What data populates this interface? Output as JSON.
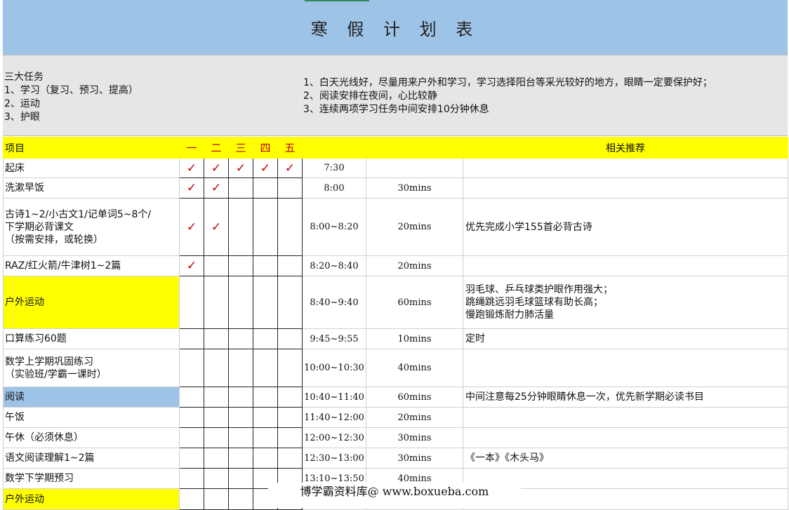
{
  "title": "寒 假 计 划 表",
  "tasks": {
    "heading": "三大任务",
    "items": [
      "1、学习（复习、预习、提高）",
      "2、运动",
      "3、护眼"
    ]
  },
  "notes": [
    "1、白天光线好，尽量用来户外和学习，学习选择阳台等采光较好的地方，眼睛一定要保护好；",
    "2、阅读安排在夜间，心比较静",
    "3、连续两项学习任务中间安排10分钟休息"
  ],
  "table": {
    "headers": {
      "item": "项目",
      "days": [
        "一",
        "二",
        "三",
        "四",
        "五"
      ],
      "recommend": "相关推荐"
    },
    "check_mark": "✓",
    "rows": [
      {
        "item": [
          "起床"
        ],
        "checks": [
          1,
          1,
          1,
          1,
          1
        ],
        "time": "7:30",
        "duration": "",
        "recommend": [],
        "style": ""
      },
      {
        "item": [
          "洗漱早饭"
        ],
        "checks": [
          1,
          1,
          0,
          0,
          0
        ],
        "time": "8:00",
        "duration": "30mins",
        "recommend": [],
        "style": ""
      },
      {
        "item": [
          "古诗1~2/小古文1/记单词5~8个/",
          "下学期必背课文",
          "（按需安排，或轮换）"
        ],
        "checks": [
          1,
          1,
          0,
          0,
          0
        ],
        "time": "8:00~8:20",
        "duration": "20mins",
        "recommend": [
          "优先完成小学155首必背古诗"
        ],
        "style": ""
      },
      {
        "item": [
          "RAZ/红火箭/牛津树1~2篇"
        ],
        "checks": [
          1,
          0,
          0,
          0,
          0
        ],
        "time": "8:20~8:40",
        "duration": "20mins",
        "recommend": [],
        "style": ""
      },
      {
        "item": [
          "户外运动"
        ],
        "checks": [
          0,
          0,
          0,
          0,
          0
        ],
        "time": "8:40~9:40",
        "duration": "60mins",
        "recommend": [
          "羽毛球、乒乓球类护眼作用强大；",
          "跳绳跳远羽毛球篮球有助长高；",
          "慢跑锻炼耐力肺活量"
        ],
        "style": "yellow"
      },
      {
        "item": [
          "口算练习60题"
        ],
        "checks": [
          0,
          0,
          0,
          0,
          0
        ],
        "time": "9:45~9:55",
        "duration": "10mins",
        "recommend": [
          "定时"
        ],
        "style": ""
      },
      {
        "item": [
          "数学上学期巩固练习",
          "（实验班/学霸一课时）"
        ],
        "checks": [
          0,
          0,
          0,
          0,
          0
        ],
        "time": "10:00~10:30",
        "duration": "40mins",
        "recommend": [],
        "style": ""
      },
      {
        "item": [
          "阅读"
        ],
        "checks": [
          0,
          0,
          0,
          0,
          0
        ],
        "time": "10:40~11:40",
        "duration": "60mins",
        "recommend": [
          "中间注意每25分钟眼睛休息一次，优先新学期必读书目"
        ],
        "style": "blue"
      },
      {
        "item": [
          "午饭"
        ],
        "checks": [
          0,
          0,
          0,
          0,
          0
        ],
        "time": "11:40~12:00",
        "duration": "20mins",
        "recommend": [],
        "style": ""
      },
      {
        "item": [
          "午休（必须休息）"
        ],
        "checks": [
          0,
          0,
          0,
          0,
          0
        ],
        "time": "12:00~12:30",
        "duration": "30mins",
        "recommend": [],
        "style": ""
      },
      {
        "item": [
          "语文阅读理解1~2篇"
        ],
        "checks": [
          0,
          0,
          0,
          0,
          0
        ],
        "time": "12:30~13:00",
        "duration": "30mins",
        "recommend": [
          "《一本》《木头马》"
        ],
        "style": ""
      },
      {
        "item": [
          "数学下学期预习"
        ],
        "checks": [
          0,
          0,
          0,
          0,
          0
        ],
        "time": "13:10~13:50",
        "duration": "40mins",
        "recommend": [],
        "style": ""
      },
      {
        "item": [
          "户外运动"
        ],
        "checks": [
          0,
          0,
          0,
          0,
          0
        ],
        "time": "",
        "duration": "",
        "recommend": [],
        "style": "yellow"
      }
    ]
  },
  "watermark": "博学霸资料库@ www.boxueba.com"
}
